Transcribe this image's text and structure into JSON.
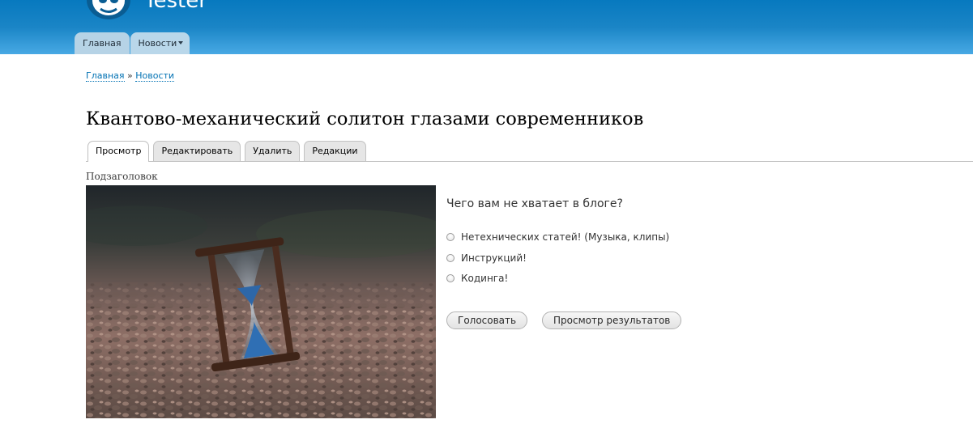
{
  "site": {
    "name": "Tester"
  },
  "main_menu": [
    {
      "label": "Главная"
    },
    {
      "label": "Новости"
    }
  ],
  "breadcrumb": {
    "home": "Главная",
    "separator": "»",
    "current": "Новости"
  },
  "node": {
    "title": "Квантово-механический солитон глазами современников",
    "subheading": "Подзаголовок"
  },
  "tabs": [
    {
      "label": "Просмотр",
      "active": true
    },
    {
      "label": "Редактировать",
      "active": false
    },
    {
      "label": "Удалить",
      "active": false
    },
    {
      "label": "Редакции",
      "active": false
    }
  ],
  "poll": {
    "question": "Чего вам не хватает в блоге?",
    "choices": [
      {
        "label": "Нетехнических статей! (Музыка, клипы)"
      },
      {
        "label": "Инструкций!"
      },
      {
        "label": "Кодинга!"
      }
    ],
    "vote_label": "Голосовать",
    "results_label": "Просмотр результатов"
  },
  "colors": {
    "header_top": "#0779bf",
    "header_bottom": "#48a9e4",
    "link": "#0071b3"
  },
  "icons": {
    "logo": "drupal-drop-logo"
  }
}
